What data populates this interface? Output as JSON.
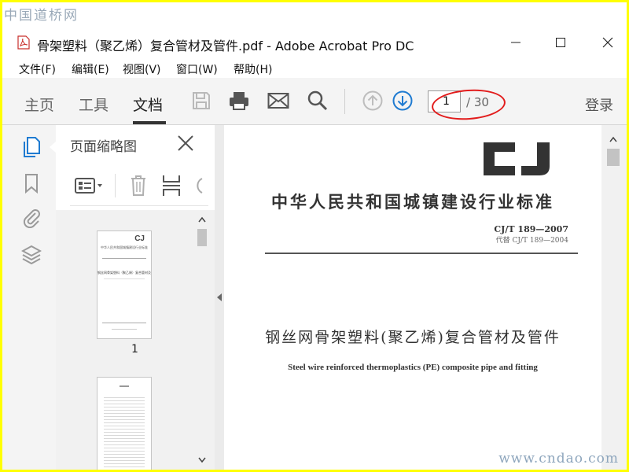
{
  "watermark": {
    "top": "中国道桥网",
    "bottom": "www.cndao.com"
  },
  "window": {
    "title": "骨架塑料（聚乙烯）复合管材及管件.pdf - Adobe Acrobat Pro DC",
    "minimize": "—",
    "maximize": "☐",
    "close": "✕"
  },
  "menu": [
    "文件(F)",
    "编辑(E)",
    "视图(V)",
    "窗口(W)",
    "帮助(H)"
  ],
  "toolbar": {
    "tabs": [
      "主页",
      "工具",
      "文档"
    ],
    "active_tab": "文档",
    "page_current": "1",
    "page_total": "/ 30",
    "login": "登录"
  },
  "thumbnails_panel": {
    "title": "页面缩略图",
    "pages": [
      "1"
    ],
    "thumb1_lines": [
      "中华人民共和国城镇建设行业标准",
      "钢丝网骨架塑料（聚乙烯）复合管材及管件"
    ]
  },
  "document": {
    "logo": "CJ",
    "title_cn": "中华人民共和国城镇建设行业标准",
    "code": "CJ/T 189—2007",
    "replaces": "代替 CJ/T 189—2004",
    "title_main": "钢丝网骨架塑料(聚乙烯)复合管材及管件",
    "title_en": "Steel wire reinforced thermoplastics (PE) composite pipe and fitting"
  },
  "colors": {
    "accent_blue": "#1f7bd1",
    "highlight_red": "#e21c1c",
    "frame_yellow": "#ffff00"
  }
}
